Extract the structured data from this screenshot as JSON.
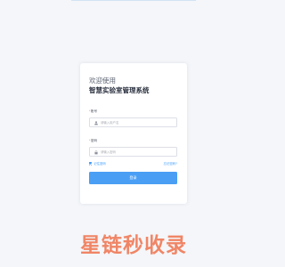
{
  "login": {
    "welcome": "欢迎使用",
    "title": "智慧实验室管理系统",
    "account_label": "账号",
    "account_placeholder": "请输入用户名",
    "password_label": "密码",
    "password_placeholder": "请输入密码",
    "remember_label": "记住密码",
    "forgot_label": "忘记密码?",
    "submit_label": "登录",
    "required_mark": "*"
  },
  "icons": {
    "account": "user-icon",
    "password": "lock-icon"
  },
  "colors": {
    "accent": "#409eff",
    "button": "#4a9ff5",
    "page_background": "#f4f6f9",
    "watermark": "#f07c5a"
  },
  "watermark": {
    "text": "星链秒收录"
  }
}
